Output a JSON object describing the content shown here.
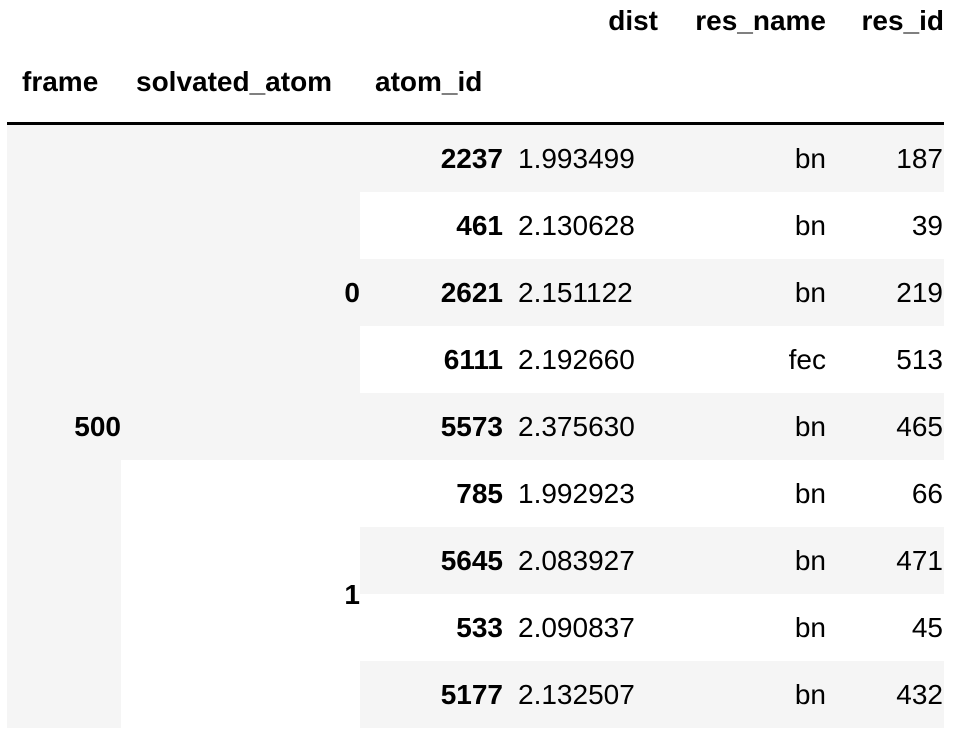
{
  "table": {
    "header_row1": {
      "dist": "dist",
      "res_name": "res_name",
      "res_id": "res_id"
    },
    "header_row2": {
      "frame": "frame",
      "solvated_atom": "solvated_atom",
      "atom_id": "atom_id"
    },
    "frame_value": "500",
    "groups": [
      {
        "solvated_atom": "0",
        "rows": [
          {
            "atom_id": "2237",
            "dist": "1.993499",
            "res_name": "bn",
            "res_id": "187"
          },
          {
            "atom_id": "461",
            "dist": "2.130628",
            "res_name": "bn",
            "res_id": "39"
          },
          {
            "atom_id": "2621",
            "dist": "2.151122",
            "res_name": "bn",
            "res_id": "219"
          },
          {
            "atom_id": "6111",
            "dist": "2.192660",
            "res_name": "fec",
            "res_id": "513"
          },
          {
            "atom_id": "5573",
            "dist": "2.375630",
            "res_name": "bn",
            "res_id": "465"
          }
        ]
      },
      {
        "solvated_atom": "1",
        "rows": [
          {
            "atom_id": "785",
            "dist": "1.992923",
            "res_name": "bn",
            "res_id": "66"
          },
          {
            "atom_id": "5645",
            "dist": "2.083927",
            "res_name": "bn",
            "res_id": "471"
          },
          {
            "atom_id": "533",
            "dist": "2.090837",
            "res_name": "bn",
            "res_id": "45"
          },
          {
            "atom_id": "5177",
            "dist": "2.132507",
            "res_name": "bn",
            "res_id": "432"
          }
        ]
      }
    ]
  }
}
